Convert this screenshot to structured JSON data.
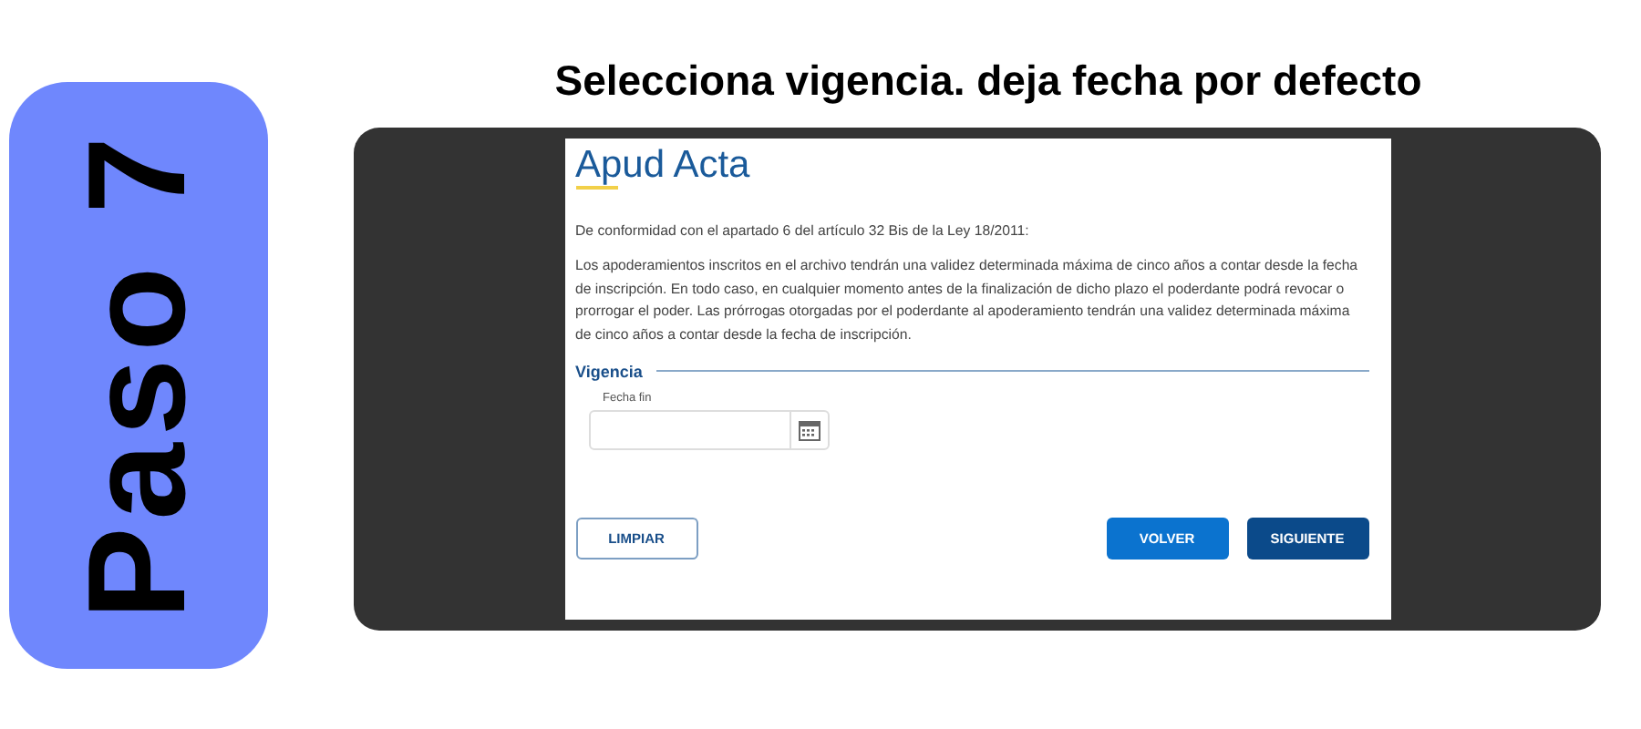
{
  "step_badge": "Paso 7",
  "instruction": "Selecciona vigencia. deja fecha por defecto",
  "screen": {
    "title": "Apud Acta",
    "intro": "De conformidad con el apartado 6 del artículo 32 Bis de la Ley 18/2011:",
    "paragraph": "Los apoderamientos inscritos en el archivo tendrán una validez determinada máxima de cinco años a contar desde la fecha de inscripción. En todo caso, en cualquier momento antes de la finalización de dicho plazo el poderdante podrá revocar o prorrogar el poder. Las prórrogas otorgadas por el poderdante al apoderamiento tendrán una validez determinada máxima de cinco años a contar desde la fecha de inscripción.",
    "section": "Vigencia",
    "date_field": {
      "label": "Fecha fin"
    },
    "buttons": [
      {
        "label": "LIMPIAR",
        "kind": "outline"
      },
      {
        "label": "VOLVER",
        "kind": "primary"
      },
      {
        "label": "SIGUIENTE",
        "kind": "dark"
      }
    ]
  }
}
